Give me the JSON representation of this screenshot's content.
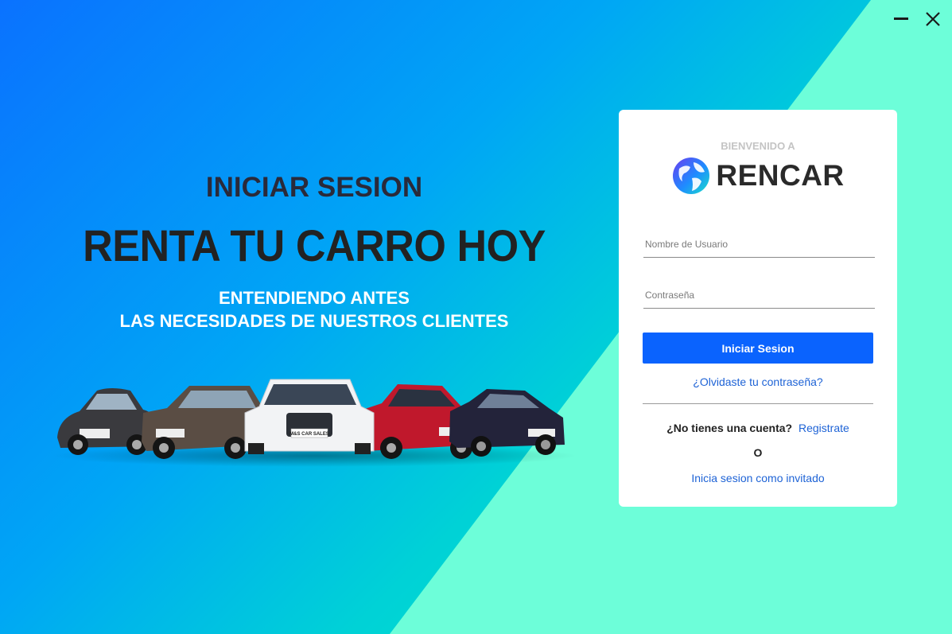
{
  "window": {
    "minimize_icon": "minimize-icon",
    "close_icon": "close-icon"
  },
  "hero": {
    "subtitle": "INICIAR SESION",
    "title": "RENTA TU CARRO HOY",
    "tagline_line1": "ENTENDIENDO ANTES",
    "tagline_line2": "LAS NECESIDADES DE NUESTROS CLIENTES",
    "plate_text": "M&S CAR SALES"
  },
  "login": {
    "welcome": "BIENVENIDO A",
    "brand": "RENCAR",
    "username_placeholder": "Nombre de Usuario",
    "username_value": "",
    "password_placeholder": "Contraseña",
    "password_value": "",
    "submit_label": "Iniciar Sesion",
    "forgot_label": "¿Olvidaste tu contraseña?",
    "no_account_label": "¿No tienes una cuenta?",
    "register_label": "Registrate",
    "or_label": "O",
    "guest_label": "Inicia sesion como invitado"
  },
  "colors": {
    "primary": "#0a63fe",
    "link": "#1e63d6",
    "accent_mint": "#6dfed9"
  }
}
